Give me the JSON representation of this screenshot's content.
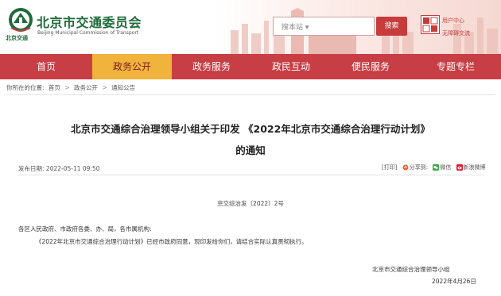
{
  "header": {
    "org_name_cn": "北京市交通委员会",
    "org_name_en": "Beijing Municipal Commission of Transport",
    "logo_small_text": "北京交通",
    "search_scope": "搜本站 ▾",
    "search_button": "搜索",
    "user_center": "用户中心",
    "accessibility": "无障碍交流"
  },
  "nav": {
    "items": [
      "首页",
      "政务公开",
      "政务服务",
      "政民互动",
      "便民服务",
      "专题专栏"
    ],
    "active_index": 1,
    "colors": {
      "bar": "#c83e45",
      "active": "#f0b33c"
    }
  },
  "breadcrumb": {
    "prefix": "你所在的位置:",
    "items": [
      "首页",
      "政务公开",
      "通知公告"
    ],
    "separator": ">"
  },
  "article": {
    "title_line1": "北京市交通综合治理领导小组关于印发 《2022年北京市交通综合治理行动计划》",
    "title_line2": "的通知",
    "publish_label": "发布日期:",
    "publish_date": "2022-05-11 09:50",
    "tools": {
      "print": "[打印]",
      "share": "分享到:",
      "wechat": "微信",
      "weibo": "新浪微博"
    },
    "doc_number": "京交综治发〔2022〕2号",
    "salutation": "各区人民政府、市政府各委、办、局，各市属机构:",
    "body": "《2022年北京市交通综合治理行动计划》已经市政府同意，现印发给你们，请结合实际认真贯彻执行。",
    "signer": "北京市交通综合治理领导小组",
    "sign_date": "2022年4月26日"
  }
}
